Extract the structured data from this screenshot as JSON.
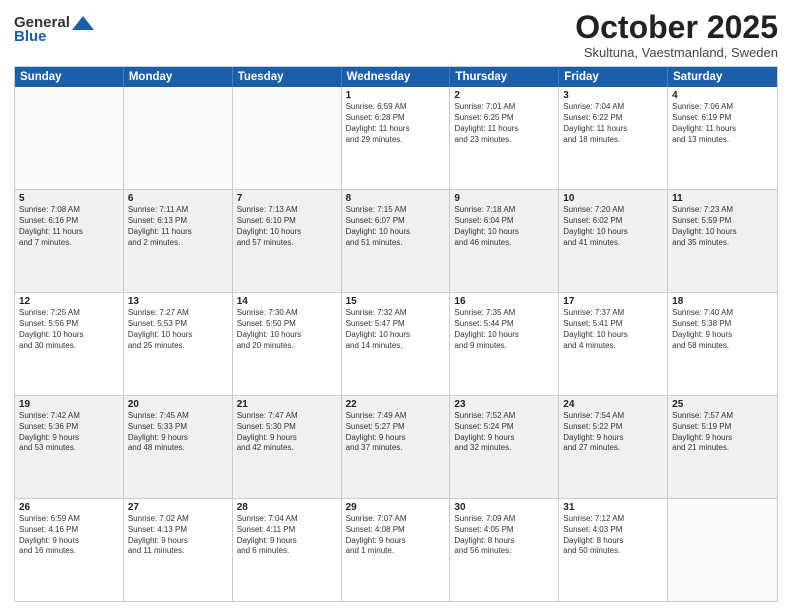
{
  "header": {
    "logo_general": "General",
    "logo_blue": "Blue",
    "month_title": "October 2025",
    "location": "Skultuna, Vaestmanland, Sweden"
  },
  "weekdays": [
    "Sunday",
    "Monday",
    "Tuesday",
    "Wednesday",
    "Thursday",
    "Friday",
    "Saturday"
  ],
  "weeks": [
    [
      {
        "day": "",
        "info": ""
      },
      {
        "day": "",
        "info": ""
      },
      {
        "day": "",
        "info": ""
      },
      {
        "day": "1",
        "info": "Sunrise: 6:59 AM\nSunset: 6:28 PM\nDaylight: 11 hours\nand 29 minutes."
      },
      {
        "day": "2",
        "info": "Sunrise: 7:01 AM\nSunset: 6:25 PM\nDaylight: 11 hours\nand 23 minutes."
      },
      {
        "day": "3",
        "info": "Sunrise: 7:04 AM\nSunset: 6:22 PM\nDaylight: 11 hours\nand 18 minutes."
      },
      {
        "day": "4",
        "info": "Sunrise: 7:06 AM\nSunset: 6:19 PM\nDaylight: 11 hours\nand 13 minutes."
      }
    ],
    [
      {
        "day": "5",
        "info": "Sunrise: 7:08 AM\nSunset: 6:16 PM\nDaylight: 11 hours\nand 7 minutes."
      },
      {
        "day": "6",
        "info": "Sunrise: 7:11 AM\nSunset: 6:13 PM\nDaylight: 11 hours\nand 2 minutes."
      },
      {
        "day": "7",
        "info": "Sunrise: 7:13 AM\nSunset: 6:10 PM\nDaylight: 10 hours\nand 57 minutes."
      },
      {
        "day": "8",
        "info": "Sunrise: 7:15 AM\nSunset: 6:07 PM\nDaylight: 10 hours\nand 51 minutes."
      },
      {
        "day": "9",
        "info": "Sunrise: 7:18 AM\nSunset: 6:04 PM\nDaylight: 10 hours\nand 46 minutes."
      },
      {
        "day": "10",
        "info": "Sunrise: 7:20 AM\nSunset: 6:02 PM\nDaylight: 10 hours\nand 41 minutes."
      },
      {
        "day": "11",
        "info": "Sunrise: 7:23 AM\nSunset: 5:59 PM\nDaylight: 10 hours\nand 35 minutes."
      }
    ],
    [
      {
        "day": "12",
        "info": "Sunrise: 7:25 AM\nSunset: 5:56 PM\nDaylight: 10 hours\nand 30 minutes."
      },
      {
        "day": "13",
        "info": "Sunrise: 7:27 AM\nSunset: 5:53 PM\nDaylight: 10 hours\nand 25 minutes."
      },
      {
        "day": "14",
        "info": "Sunrise: 7:30 AM\nSunset: 5:50 PM\nDaylight: 10 hours\nand 20 minutes."
      },
      {
        "day": "15",
        "info": "Sunrise: 7:32 AM\nSunset: 5:47 PM\nDaylight: 10 hours\nand 14 minutes."
      },
      {
        "day": "16",
        "info": "Sunrise: 7:35 AM\nSunset: 5:44 PM\nDaylight: 10 hours\nand 9 minutes."
      },
      {
        "day": "17",
        "info": "Sunrise: 7:37 AM\nSunset: 5:41 PM\nDaylight: 10 hours\nand 4 minutes."
      },
      {
        "day": "18",
        "info": "Sunrise: 7:40 AM\nSunset: 5:38 PM\nDaylight: 9 hours\nand 58 minutes."
      }
    ],
    [
      {
        "day": "19",
        "info": "Sunrise: 7:42 AM\nSunset: 5:36 PM\nDaylight: 9 hours\nand 53 minutes."
      },
      {
        "day": "20",
        "info": "Sunrise: 7:45 AM\nSunset: 5:33 PM\nDaylight: 9 hours\nand 48 minutes."
      },
      {
        "day": "21",
        "info": "Sunrise: 7:47 AM\nSunset: 5:30 PM\nDaylight: 9 hours\nand 42 minutes."
      },
      {
        "day": "22",
        "info": "Sunrise: 7:49 AM\nSunset: 5:27 PM\nDaylight: 9 hours\nand 37 minutes."
      },
      {
        "day": "23",
        "info": "Sunrise: 7:52 AM\nSunset: 5:24 PM\nDaylight: 9 hours\nand 32 minutes."
      },
      {
        "day": "24",
        "info": "Sunrise: 7:54 AM\nSunset: 5:22 PM\nDaylight: 9 hours\nand 27 minutes."
      },
      {
        "day": "25",
        "info": "Sunrise: 7:57 AM\nSunset: 5:19 PM\nDaylight: 9 hours\nand 21 minutes."
      }
    ],
    [
      {
        "day": "26",
        "info": "Sunrise: 6:59 AM\nSunset: 4:16 PM\nDaylight: 9 hours\nand 16 minutes."
      },
      {
        "day": "27",
        "info": "Sunrise: 7:02 AM\nSunset: 4:13 PM\nDaylight: 9 hours\nand 11 minutes."
      },
      {
        "day": "28",
        "info": "Sunrise: 7:04 AM\nSunset: 4:11 PM\nDaylight: 9 hours\nand 6 minutes."
      },
      {
        "day": "29",
        "info": "Sunrise: 7:07 AM\nSunset: 4:08 PM\nDaylight: 9 hours\nand 1 minute."
      },
      {
        "day": "30",
        "info": "Sunrise: 7:09 AM\nSunset: 4:05 PM\nDaylight: 8 hours\nand 56 minutes."
      },
      {
        "day": "31",
        "info": "Sunrise: 7:12 AM\nSunset: 4:03 PM\nDaylight: 8 hours\nand 50 minutes."
      },
      {
        "day": "",
        "info": ""
      }
    ]
  ]
}
